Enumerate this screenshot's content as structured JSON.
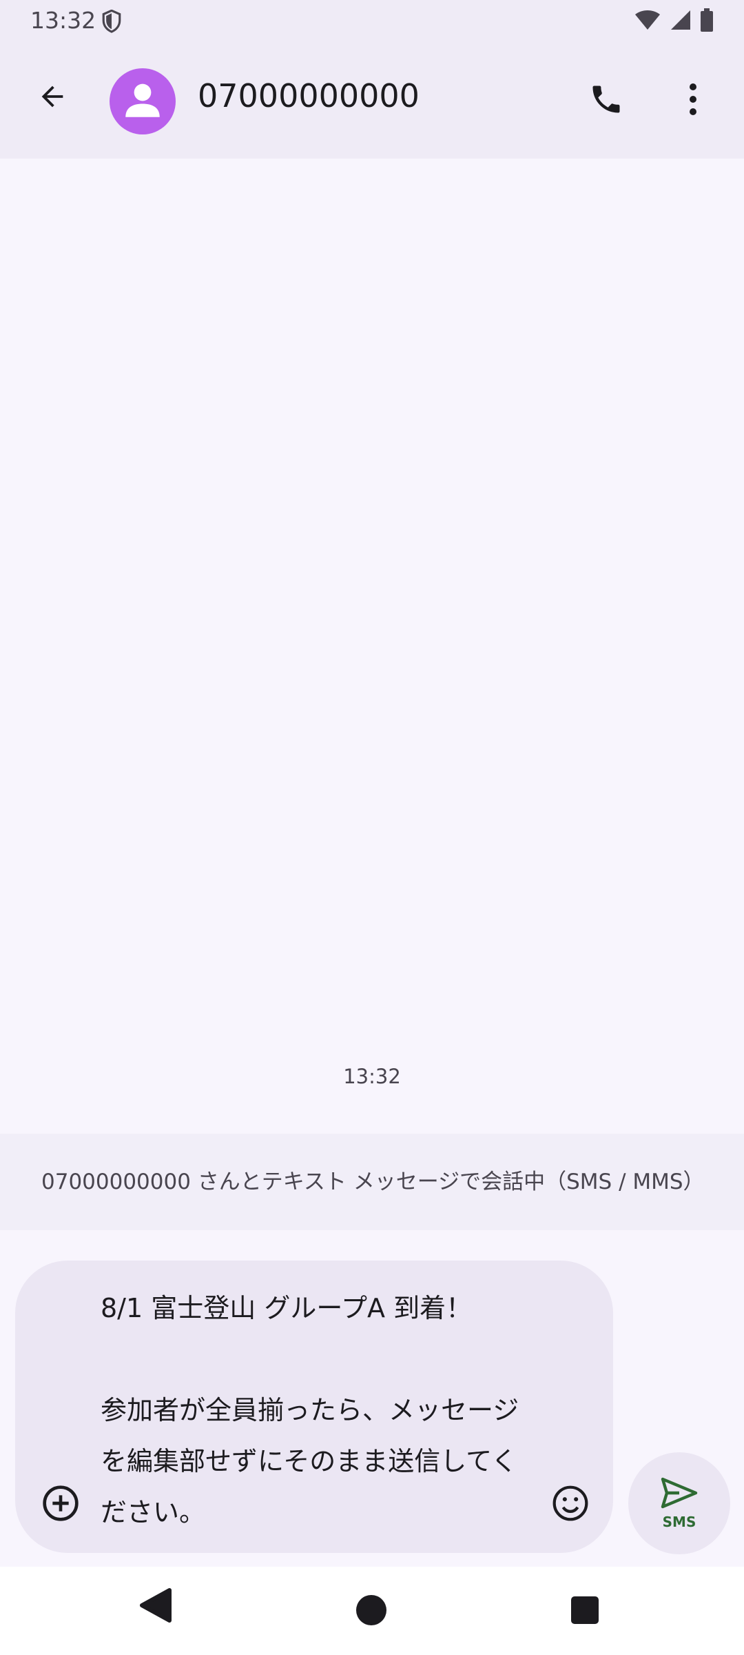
{
  "status_bar": {
    "time": "13:32",
    "icons": [
      "shield-icon",
      "wifi-icon",
      "signal-icon",
      "battery-icon"
    ]
  },
  "app_bar": {
    "title": "07000000000",
    "avatar_color": "#b960ec",
    "icons": [
      "back-arrow-icon",
      "person-icon",
      "phone-icon",
      "more-vert-icon"
    ]
  },
  "conversation": {
    "timestamp": "13:32"
  },
  "info_banner": {
    "text": "07000000000 さんとテキスト メッセージで会話中（SMS / MMS）"
  },
  "composer": {
    "message": "8/1 富士登山 グループA 到着！\n\n参加者が全員揃ったら、メッセージを編集部せずにそのまま送信してください。",
    "icons": [
      "add-circle-icon",
      "emoji-icon"
    ]
  },
  "send_button": {
    "label": "SMS",
    "color": "#2e6b33",
    "icon": "send-icon"
  },
  "nav_bar": {
    "icons": [
      "nav-back-icon",
      "nav-home-icon",
      "nav-recents-icon"
    ]
  }
}
